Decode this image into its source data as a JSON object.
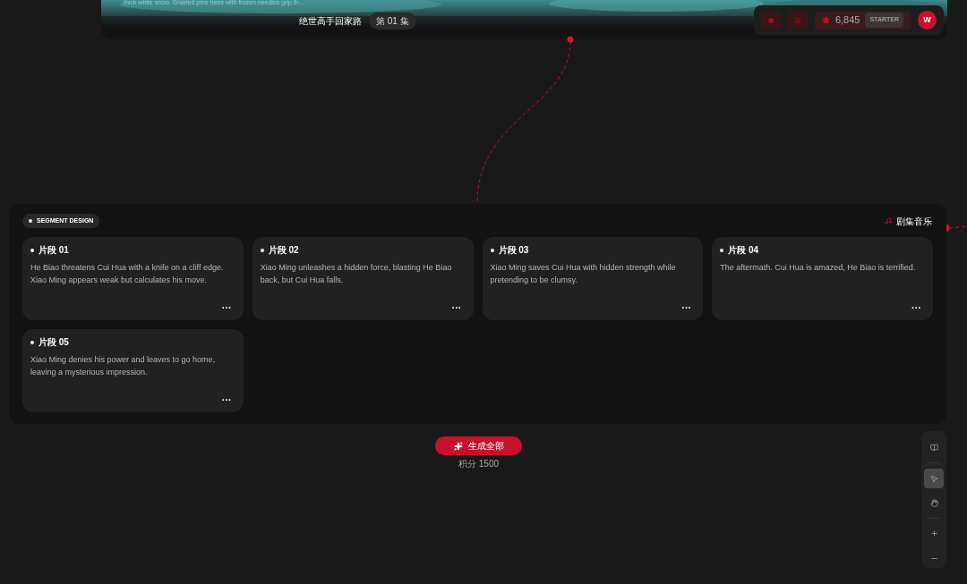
{
  "header": {
    "caption": "thick white snow. Gnarled pine trees with frozen needles grip th...",
    "title": "绝世高手回家路",
    "episode": "第 01 集",
    "credits": "6,845",
    "plan": "STARTER",
    "avatar": "W"
  },
  "segment_panel": {
    "label": "SEGMENT DESIGN",
    "music": "剧集音乐",
    "segments": [
      {
        "title": "片段 01",
        "text": "He Biao threatens Cui Hua with a knife on a cliff edge. Xiao Ming appears weak but calculates his move.",
        "more": "···"
      },
      {
        "title": "片段 02",
        "text": "Xiao Ming unleashes a hidden force, blasting He Biao back, but Cui Hua falls.",
        "more": "···"
      },
      {
        "title": "片段 03",
        "text": "Xiao Ming saves Cui Hua with hidden strength while pretending to be clumsy.",
        "more": "···"
      },
      {
        "title": "片段 04",
        "text": "The aftermath. Cui Hua is amazed, He Biao is terrified.",
        "more": "···"
      },
      {
        "title": "片段 05",
        "text": "Xiao Ming denies his power and leaves to go home, leaving a mysterious impression.",
        "more": "···"
      }
    ]
  },
  "generate": {
    "label": "生成全部",
    "cost": "积分 1500"
  },
  "toolbar": [
    {
      "kind": "book",
      "selected": false
    },
    {
      "kind": "pointer",
      "selected": true
    },
    {
      "kind": "hand",
      "selected": false
    },
    {
      "kind": "plus",
      "selected": false
    },
    {
      "kind": "minus",
      "selected": false
    }
  ]
}
